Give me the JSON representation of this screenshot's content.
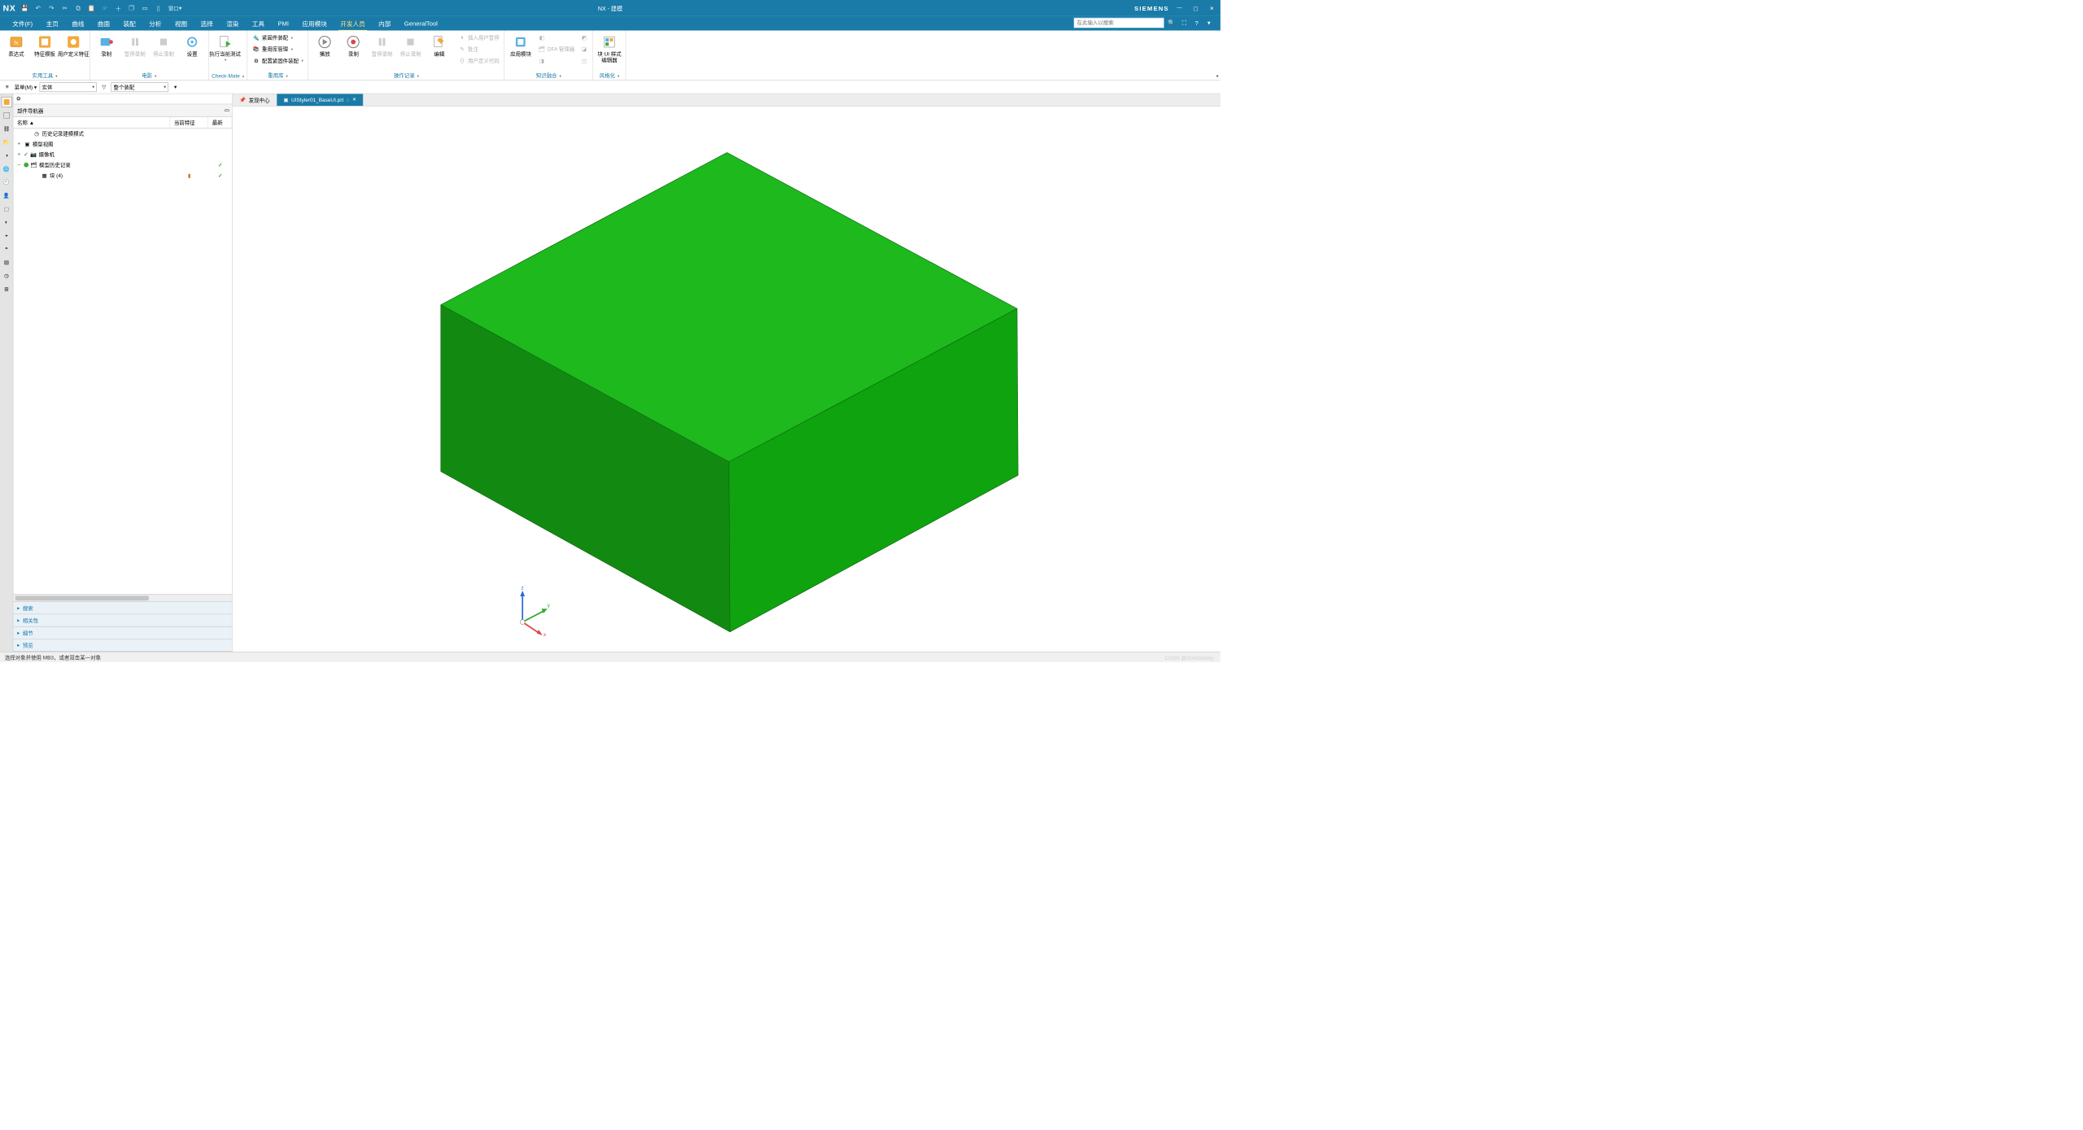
{
  "title_bar": {
    "app": "NX",
    "doc_title": "NX - 建模",
    "brand": "SIEMENS"
  },
  "quick_access": [
    "save",
    "undo",
    "redo",
    "cut",
    "copy",
    "paste",
    "touch",
    "plus",
    "cascade",
    "tile-h",
    "tile-v",
    "window"
  ],
  "qat_window_label": "窗口",
  "menu": {
    "items": [
      "文件(F)",
      "主页",
      "曲线",
      "曲面",
      "装配",
      "分析",
      "视图",
      "选择",
      "渲染",
      "工具",
      "PMI",
      "应用模块",
      "开发人员",
      "内部",
      "GeneralTool"
    ],
    "active_index": 12
  },
  "search": {
    "placeholder": "在此输入以搜索"
  },
  "ribbon": {
    "groups": [
      {
        "label": "实用工具",
        "big": [
          {
            "name": "表达式",
            "icon": "fx"
          },
          {
            "name": "特征模板",
            "icon": "tpl"
          },
          {
            "name": "用户定义特征",
            "icon": "udf"
          }
        ]
      },
      {
        "label": "电影",
        "big": [
          {
            "name": "录制",
            "icon": "rec"
          },
          {
            "name": "暂停录制",
            "icon": "pause",
            "disabled": true
          },
          {
            "name": "停止录制",
            "icon": "stop",
            "disabled": true
          },
          {
            "name": "设置",
            "icon": "gear"
          }
        ]
      },
      {
        "label": "Check-Mate",
        "big": [
          {
            "name": "执行当前测试",
            "icon": "play-doc"
          }
        ]
      },
      {
        "label": "重用库",
        "small": [
          {
            "name": "紧固件装配",
            "icon": "bolt",
            "dd": true
          },
          {
            "name": "重用库管理",
            "icon": "lib",
            "dd": true
          },
          {
            "name": "配置紧固件装配",
            "icon": "cfg",
            "dd": true
          }
        ]
      },
      {
        "label": "操作记录",
        "big": [
          {
            "name": "播放",
            "icon": "play"
          },
          {
            "name": "录制",
            "icon": "rec2"
          },
          {
            "name": "暂停录制",
            "icon": "pause",
            "disabled": true
          },
          {
            "name": "停止录制",
            "icon": "stop",
            "disabled": true
          },
          {
            "name": "编辑",
            "icon": "edit"
          }
        ],
        "small": [
          {
            "name": "插入用户暂停",
            "icon": "ins",
            "disabled": true
          },
          {
            "name": "批注",
            "icon": "note",
            "disabled": true
          },
          {
            "name": "用户定义代码",
            "icon": "code",
            "disabled": true
          }
        ]
      },
      {
        "label": "知识融合",
        "big": [
          {
            "name": "应用模块",
            "icon": "app"
          }
        ],
        "small": [
          {
            "name": "",
            "icon": "k1",
            "disabled": true
          },
          {
            "name": "DFA 管理器",
            "icon": "dfa",
            "disabled": true
          },
          {
            "name": "",
            "icon": "k3",
            "disabled": true
          }
        ],
        "small2": [
          {
            "name": "",
            "icon": "k4",
            "disabled": true
          },
          {
            "name": "",
            "icon": "k5",
            "disabled": true
          },
          {
            "name": "",
            "icon": "k6",
            "disabled": true
          }
        ]
      },
      {
        "label": "风格化",
        "big": [
          {
            "name": "块 UI 样式编辑器",
            "icon": "blockui"
          }
        ]
      }
    ]
  },
  "selection_bar": {
    "menu_label": "菜单(M)",
    "filter1": "实体",
    "filter2": "整个装配"
  },
  "navigator": {
    "title": "部件导航器",
    "columns": [
      "名称 ▲",
      "当前特征",
      "最新"
    ],
    "rows": [
      {
        "indent": 1,
        "exp": "",
        "icon": "clock",
        "label": "历史记录建模模式",
        "cur": "",
        "latest": ""
      },
      {
        "indent": 0,
        "exp": "+",
        "icon": "views",
        "label": "模型视图",
        "cur": "",
        "latest": ""
      },
      {
        "indent": 0,
        "exp": "+",
        "icon": "camera",
        "label": "摄像机",
        "cur": "",
        "latest": "",
        "check": true
      },
      {
        "indent": 0,
        "exp": "−",
        "icon": "history",
        "label": "模型历史记录",
        "cur": "",
        "latest": "✓",
        "green": true
      },
      {
        "indent": 2,
        "exp": "",
        "icon": "block",
        "label": "块 (4)",
        "cur": "▮",
        "latest": "✓",
        "green": true
      }
    ],
    "sections": [
      "搜索",
      "相关性",
      "细节",
      "预览"
    ]
  },
  "tabs": [
    {
      "label": "发现中心",
      "active": false,
      "icon": "pin"
    },
    {
      "label": "UIStyler01_BaseUI.prt",
      "active": true,
      "closable": true,
      "dirty": true
    }
  ],
  "status": "选择对象并使用 MB3，或者双击某一对象",
  "watermark": "CSDN @GimiGimmy",
  "triad": {
    "x": "x",
    "y": "y",
    "z": "z"
  }
}
